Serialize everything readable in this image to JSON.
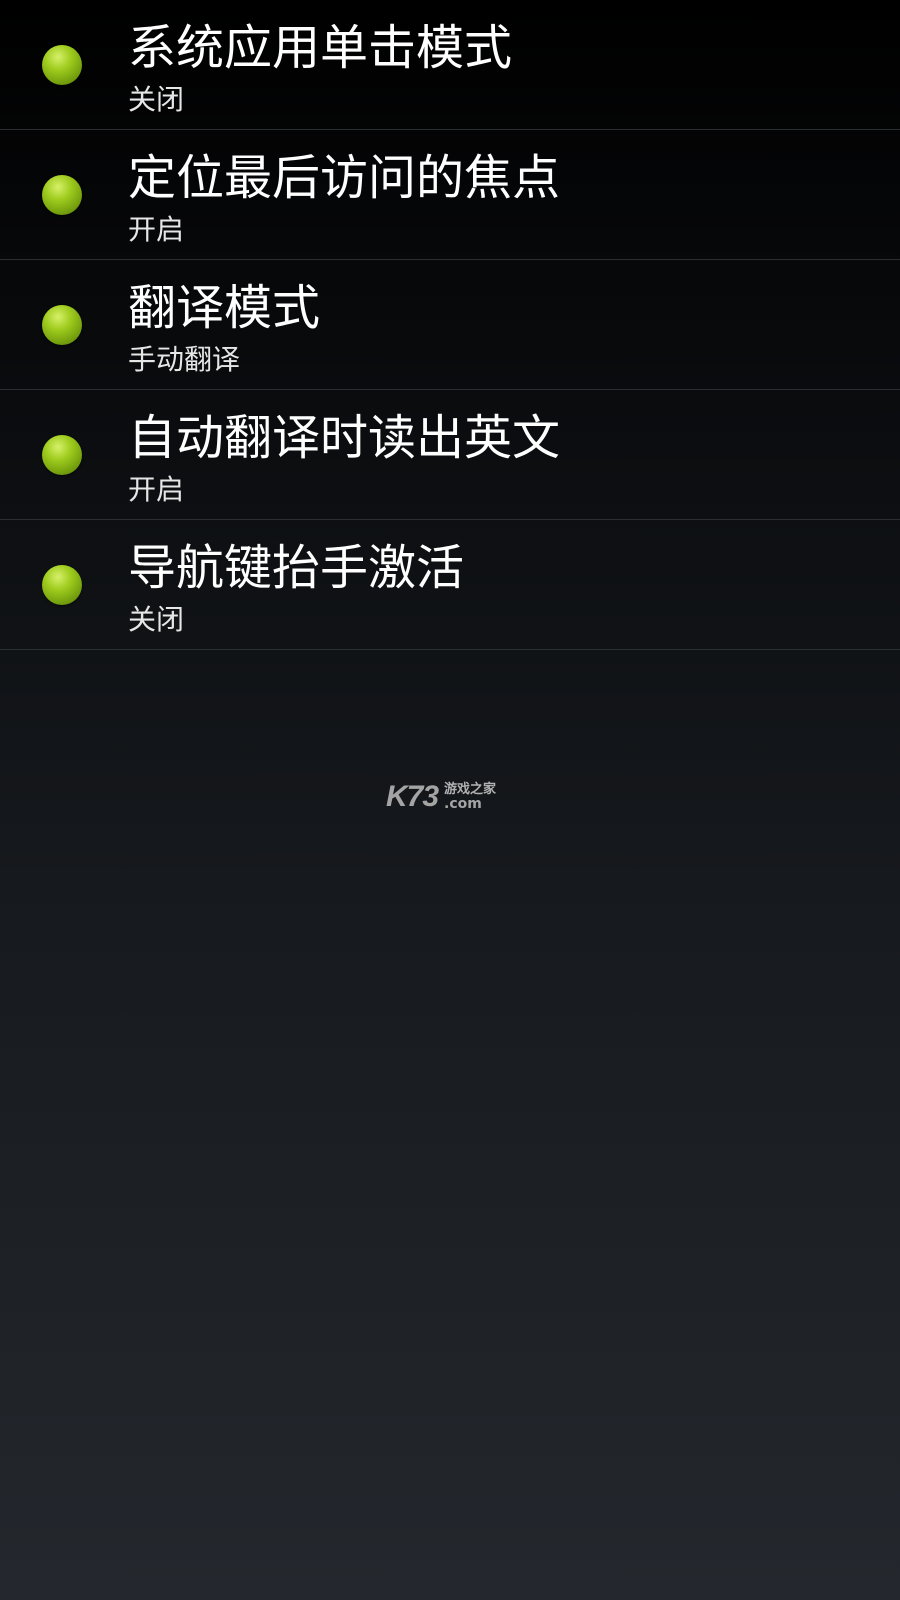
{
  "settings": [
    {
      "title": "系统应用单击模式",
      "value": "关闭"
    },
    {
      "title": "定位最后访问的焦点",
      "value": "开启"
    },
    {
      "title": "翻译模式",
      "value": "手动翻译"
    },
    {
      "title": "自动翻译时读出英文",
      "value": "开启"
    },
    {
      "title": "导航键抬手激活",
      "value": "关闭"
    }
  ],
  "watermark": {
    "brand": "K73",
    "tagline": "游戏之家",
    "domain": ".com"
  },
  "colors": {
    "indicator": "#8fbf12",
    "divider": "#2b2e33"
  },
  "icons": {
    "indicator": "green-dot-icon"
  }
}
